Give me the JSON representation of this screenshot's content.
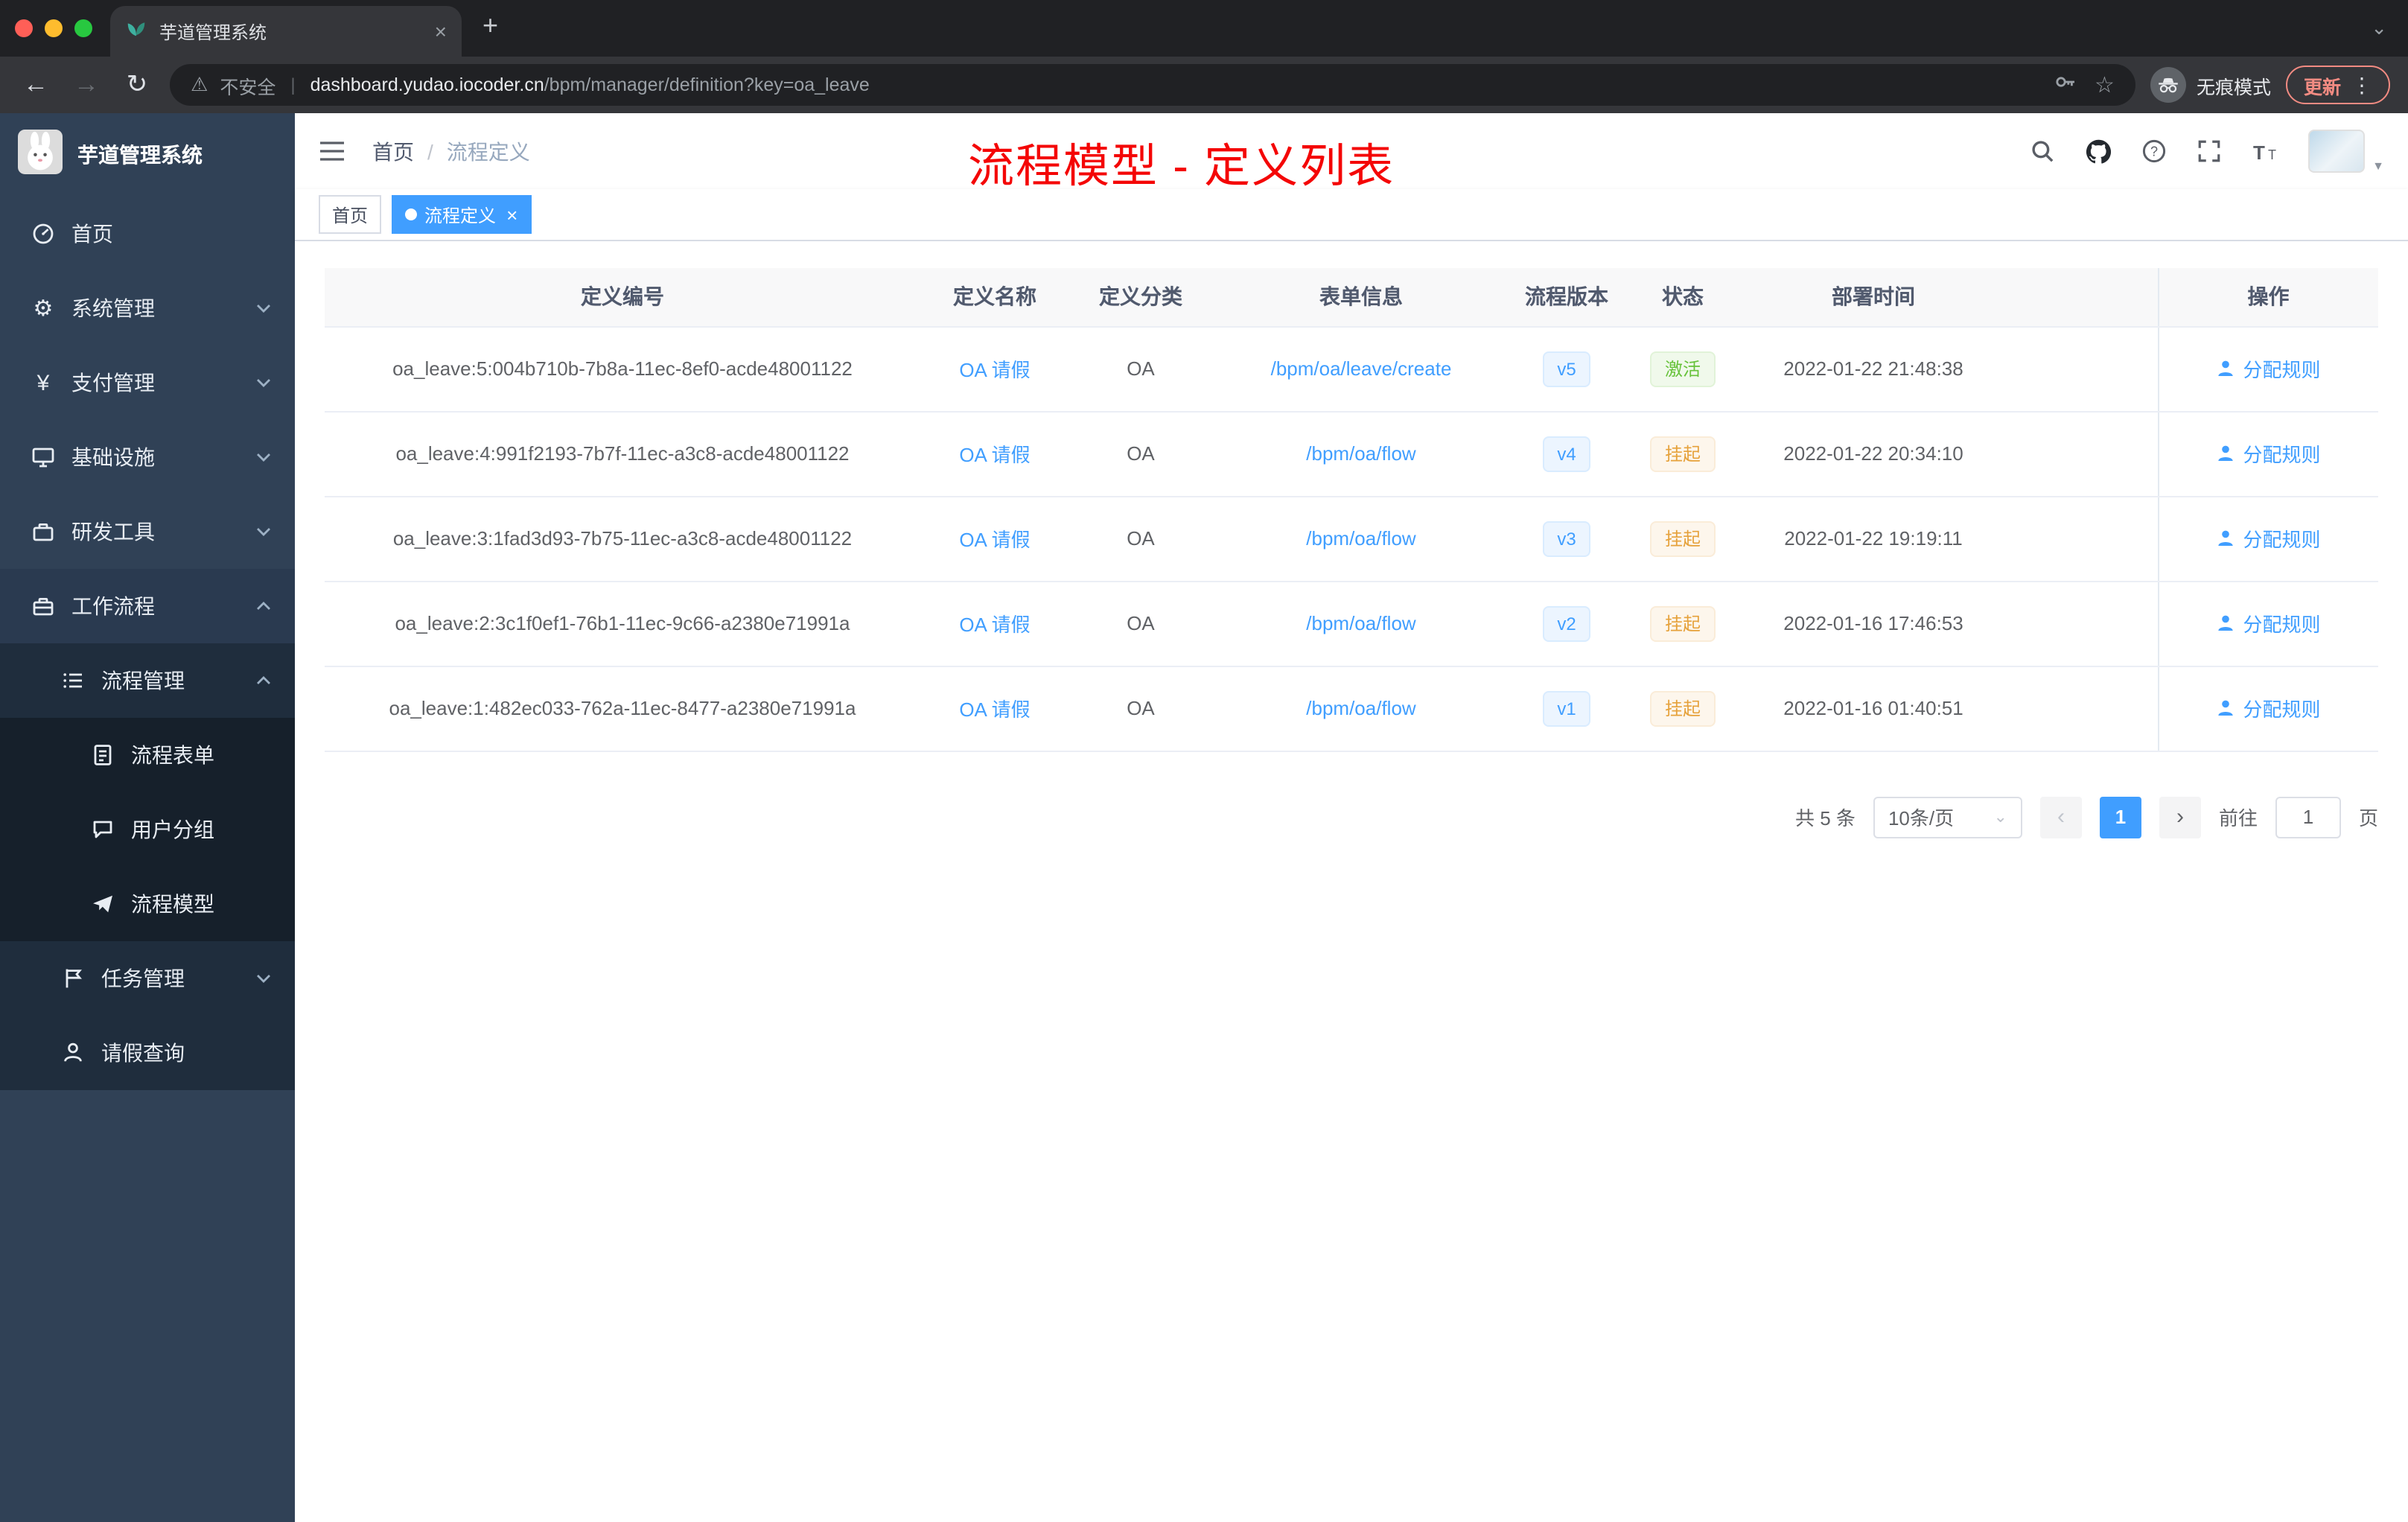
{
  "browser": {
    "tab_title": "芋道管理系统",
    "security_label": "不安全",
    "url_domain": "dashboard.yudao.iocoder.cn",
    "url_path": "/bpm/manager/definition?key=oa_leave",
    "incognito_label": "无痕模式",
    "update_label": "更新"
  },
  "icons": {
    "back": "←",
    "forward": "→",
    "reload": "↻",
    "new_tab": "+",
    "tab_close": "×",
    "tabstrip_chevron": "⌄",
    "warning": "⚠",
    "divider": "|",
    "star": "☆",
    "menu_dots": "⋮",
    "tag_close": "×",
    "select_caret": "⌄",
    "prev": "‹",
    "next": "›",
    "avatar_caret": "▼",
    "yen": "¥",
    "gear": "⚙"
  },
  "sidebar": {
    "logo_title": "芋道管理系统",
    "items": [
      {
        "label": "首页",
        "icon": "dashboard-icon"
      },
      {
        "label": "系统管理",
        "icon": "gear-icon"
      },
      {
        "label": "支付管理",
        "icon": "yen-icon"
      },
      {
        "label": "基础设施",
        "icon": "monitor-icon"
      },
      {
        "label": "研发工具",
        "icon": "toolbox-icon"
      },
      {
        "label": "工作流程",
        "icon": "briefcase-icon",
        "expanded": true
      },
      {
        "label": "流程管理",
        "icon": "list-icon",
        "expanded": true
      },
      {
        "label": "流程表单",
        "icon": "document-icon"
      },
      {
        "label": "用户分组",
        "icon": "chat-icon"
      },
      {
        "label": "流程模型",
        "icon": "send-icon"
      },
      {
        "label": "任务管理",
        "icon": "flag-icon"
      },
      {
        "label": "请假查询",
        "icon": "user-icon"
      }
    ]
  },
  "header": {
    "breadcrumb_home": "首页",
    "breadcrumb_sep": "/",
    "breadcrumb_current": "流程定义",
    "annotation": "流程模型 - 定义列表"
  },
  "tags": [
    {
      "label": "首页",
      "active": false
    },
    {
      "label": "流程定义",
      "active": true
    }
  ],
  "table": {
    "columns": [
      "定义编号",
      "定义名称",
      "定义分类",
      "表单信息",
      "流程版本",
      "状态",
      "部署时间",
      "操作"
    ],
    "action_label": "分配规则",
    "rows": [
      {
        "id": "oa_leave:5:004b710b-7b8a-11ec-8ef0-acde48001122",
        "name": "OA 请假",
        "category": "OA",
        "form": "/bpm/oa/leave/create",
        "version": "v5",
        "status": "激活",
        "status_type": "success",
        "time": "2022-01-22 21:48:38"
      },
      {
        "id": "oa_leave:4:991f2193-7b7f-11ec-a3c8-acde48001122",
        "name": "OA 请假",
        "category": "OA",
        "form": "/bpm/oa/flow",
        "version": "v4",
        "status": "挂起",
        "status_type": "warning",
        "time": "2022-01-22 20:34:10"
      },
      {
        "id": "oa_leave:3:1fad3d93-7b75-11ec-a3c8-acde48001122",
        "name": "OA 请假",
        "category": "OA",
        "form": "/bpm/oa/flow",
        "version": "v3",
        "status": "挂起",
        "status_type": "warning",
        "time": "2022-01-22 19:19:11"
      },
      {
        "id": "oa_leave:2:3c1f0ef1-76b1-11ec-9c66-a2380e71991a",
        "name": "OA 请假",
        "category": "OA",
        "form": "/bpm/oa/flow",
        "version": "v2",
        "status": "挂起",
        "status_type": "warning",
        "time": "2022-01-16 17:46:53"
      },
      {
        "id": "oa_leave:1:482ec033-762a-11ec-8477-a2380e71991a",
        "name": "OA 请假",
        "category": "OA",
        "form": "/bpm/oa/flow",
        "version": "v1",
        "status": "挂起",
        "status_type": "warning",
        "time": "2022-01-16 01:40:51"
      }
    ]
  },
  "pagination": {
    "total": "共 5 条",
    "page_size": "10条/页",
    "current_page": "1",
    "goto_prefix": "前往",
    "goto_value": "1",
    "goto_suffix": "页"
  },
  "colors": {
    "accent": "#409eff",
    "sidebar_bg": "#304156",
    "sidebar_sub_bg": "#1f2d3d",
    "success": "#67c23a",
    "warning": "#e6a23c",
    "annotation_red": "#f40606",
    "chrome_dark": "#202124",
    "chrome_toolbar": "#35363a",
    "tag_active": "#409eff",
    "table_header_bg": "#f8f8f9"
  }
}
